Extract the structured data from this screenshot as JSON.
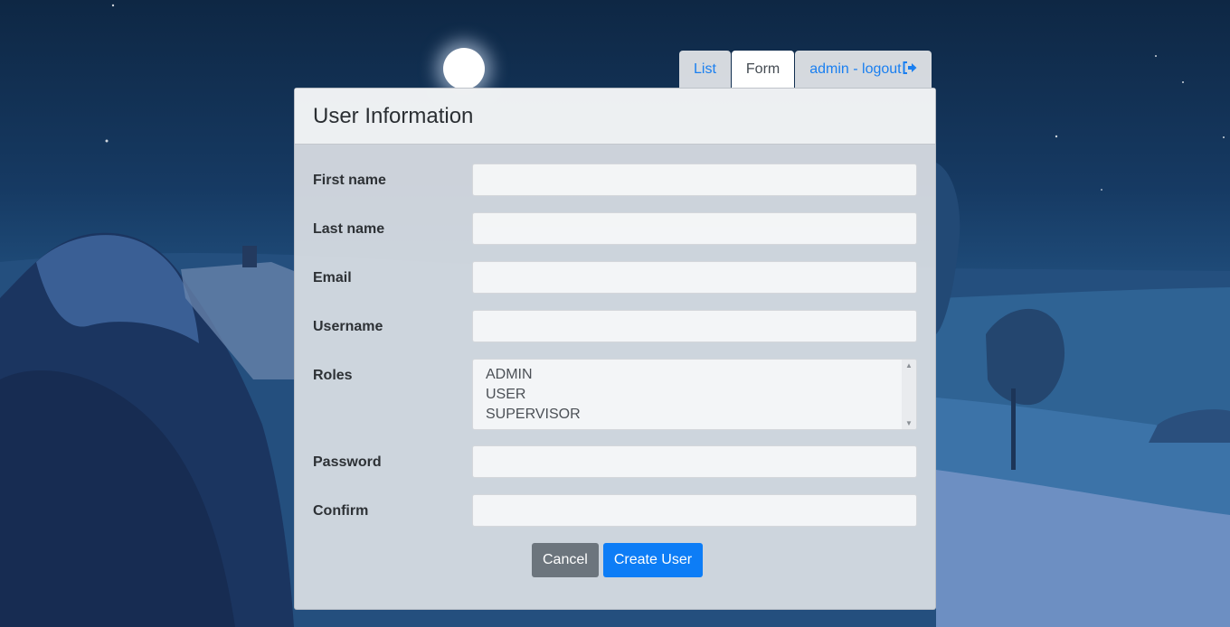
{
  "tabs": [
    {
      "label": "List",
      "active": false
    },
    {
      "label": "Form",
      "active": true
    },
    {
      "label": "admin - logout",
      "active": false,
      "icon": "sign-out-icon"
    }
  ],
  "panel": {
    "title": "User Information"
  },
  "form": {
    "first_name": {
      "label": "First name",
      "value": ""
    },
    "last_name": {
      "label": "Last name",
      "value": ""
    },
    "email": {
      "label": "Email",
      "value": ""
    },
    "username": {
      "label": "Username",
      "value": ""
    },
    "roles": {
      "label": "Roles",
      "options": [
        "ADMIN",
        "USER",
        "SUPERVISOR"
      ]
    },
    "password": {
      "label": "Password",
      "value": ""
    },
    "confirm": {
      "label": "Confirm",
      "value": ""
    }
  },
  "buttons": {
    "cancel": "Cancel",
    "create": "Create User"
  },
  "colors": {
    "primary": "#0d7df6",
    "secondary": "#6c757d",
    "link": "#1a7ff0"
  }
}
